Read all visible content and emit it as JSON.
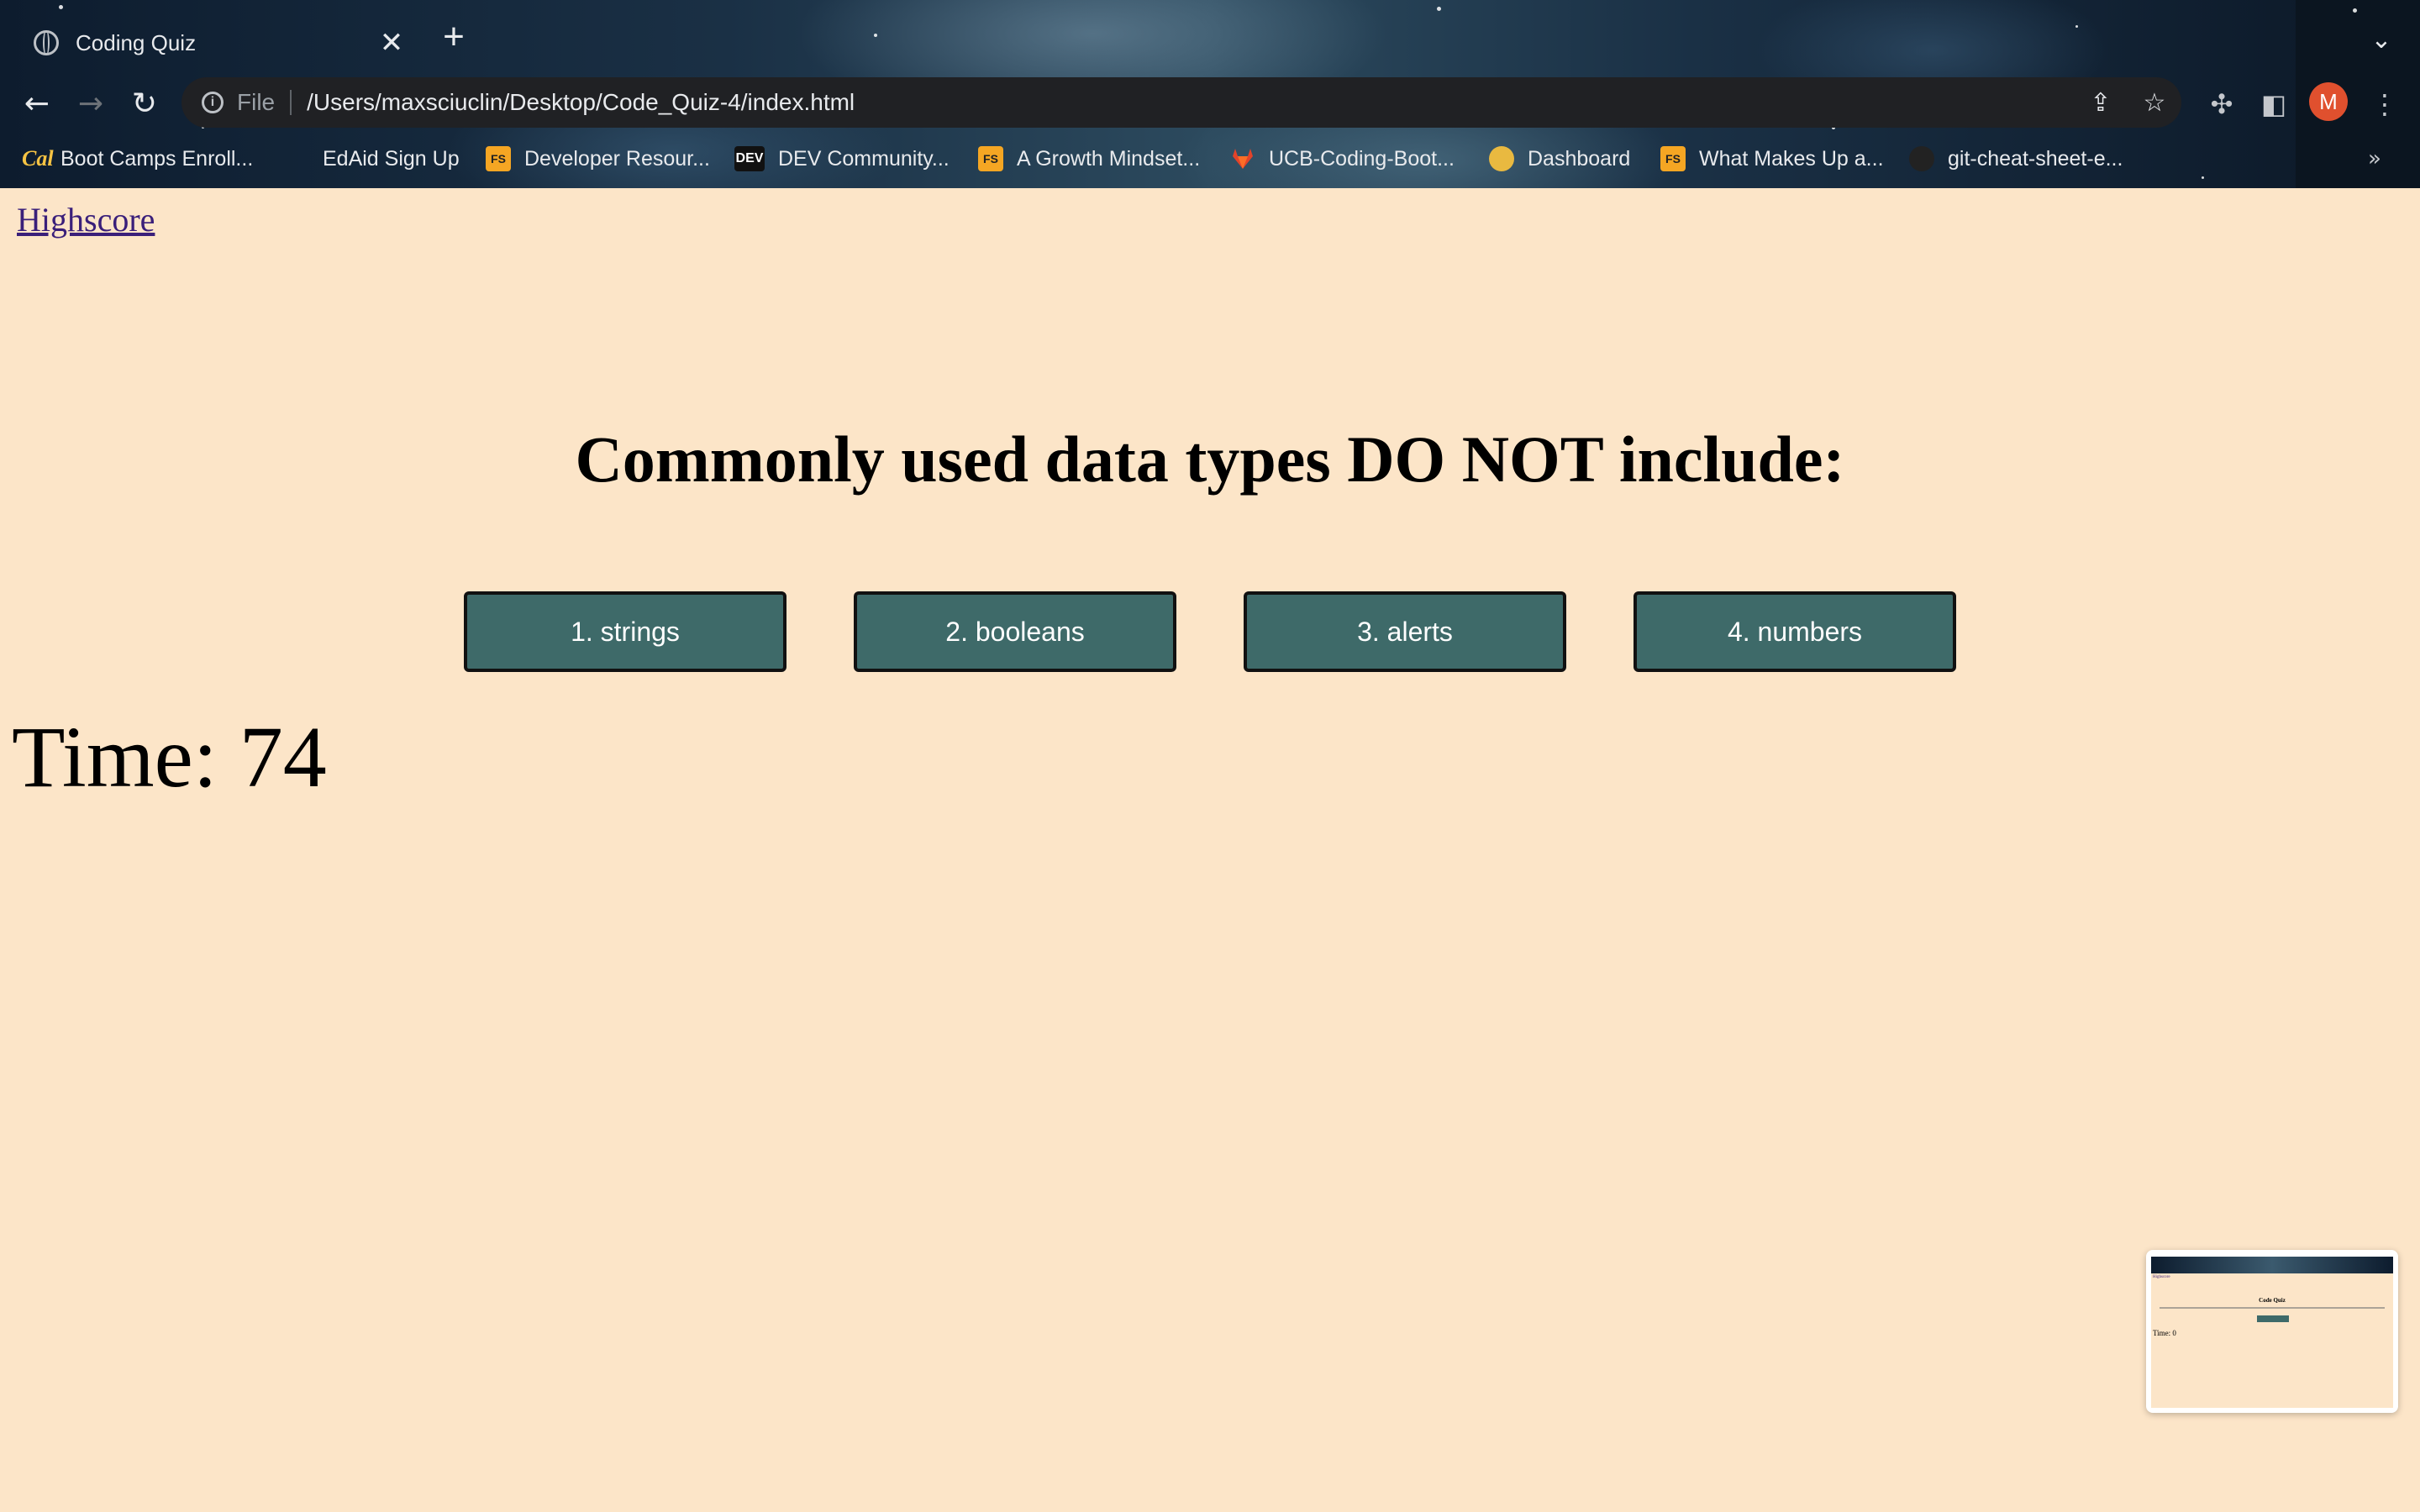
{
  "browser": {
    "tab_title": "Coding Quiz",
    "close_label": "✕",
    "new_tab_label": "+",
    "url_scheme": "File",
    "url": "/Users/maxsciuclin/Desktop/Code_Quiz-4/index.html",
    "avatar_letter": "M",
    "bookmarks": [
      {
        "label": "Boot Camps Enroll...",
        "icon": "cal-icon",
        "icon_text": "Cal"
      },
      {
        "label": "EdAid Sign Up",
        "icon": "",
        "icon_text": ""
      },
      {
        "label": "Developer Resour...",
        "icon": "fs-icon",
        "icon_text": "FS"
      },
      {
        "label": "DEV Community...",
        "icon": "dev-icon",
        "icon_text": "DEV"
      },
      {
        "label": "A Growth Mindset...",
        "icon": "fs-icon",
        "icon_text": "FS"
      },
      {
        "label": "UCB-Coding-Boot...",
        "icon": "gitlab-icon",
        "icon_text": ""
      },
      {
        "label": "Dashboard",
        "icon": "dashboard-icon",
        "icon_text": ""
      },
      {
        "label": "What Makes Up a...",
        "icon": "fs-icon",
        "icon_text": "FS"
      },
      {
        "label": "git-cheat-sheet-e...",
        "icon": "github-icon",
        "icon_text": ""
      }
    ],
    "bookmarks_more": "»"
  },
  "page": {
    "highscore_link": "Highscore",
    "question": "Commonly used data types DO NOT include:",
    "choices": [
      "1. strings",
      "2. booleans",
      "3. alerts",
      "4. numbers"
    ],
    "timer_label": "Time:",
    "timer_value": "74"
  },
  "thumbnail": {
    "title": "Code Quiz",
    "link": "Highscore",
    "time": "Time: 0"
  },
  "colors": {
    "page_background": "#fce5c8",
    "button_background": "#3e6a69",
    "link_color": "#3a1f7a"
  }
}
